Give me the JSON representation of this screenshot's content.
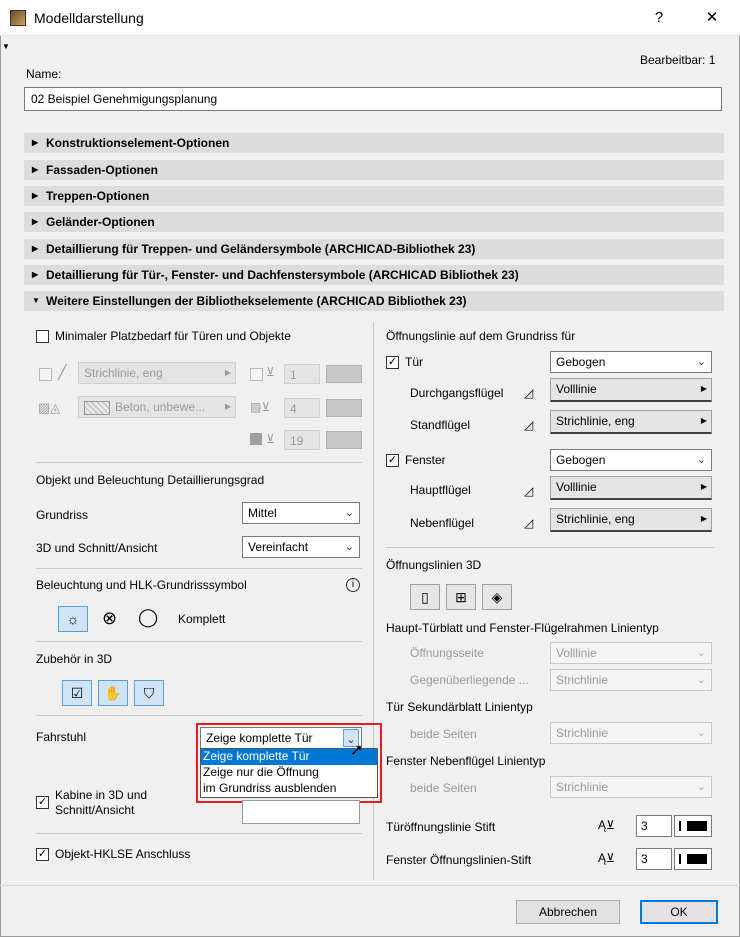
{
  "window": {
    "title": "Modelldarstellung",
    "help": "?",
    "close": "✕"
  },
  "editable": "Bearbeitbar: 1",
  "name": {
    "label": "Name:",
    "value": "02 Beispiel Genehmigungsplanung"
  },
  "sections": [
    "Konstruktionselement-Optionen",
    "Fassaden-Optionen",
    "Treppen-Optionen",
    "Geländer-Optionen",
    "Detaillierung für Treppen- und Geländersymbole (ARCHICAD-Bibliothek 23)",
    "Detaillierung für Tür-, Fenster- und Dachfenstersymbole (ARCHICAD Bibliothek 23)",
    "Weitere Einstellungen der Bibliothekselemente (ARCHICAD Bibliothek 23)"
  ],
  "left": {
    "min_space": "Minimaler Platzbedarf für Türen und Objekte",
    "line_type": "Strichlinie, eng",
    "fill": "Beton, unbewe...",
    "pen1": "1",
    "pen2": "4",
    "pen3": "19",
    "detail_title": "Objekt und Beleuchtung Detaillierungsgrad",
    "grundriss_label": "Grundriss",
    "grundriss_value": "Mittel",
    "schnitt_label": "3D und Schnitt/Ansicht",
    "schnitt_value": "Vereinfacht",
    "lighting_title": "Beleuchtung und HLK-Grundrisssymbol",
    "lighting_value": "Komplett",
    "zubehoer_title": "Zubehör in 3D",
    "fahrstuhl_label": "Fahrstuhl",
    "fahrstuhl_value": "Zeige komplette Tür",
    "fahrstuhl_options": [
      "Zeige komplette Tür",
      "Zeige nur die Öffnung",
      "im Grundriss ausblenden"
    ],
    "kabine": "Kabine in 3D und Schnitt/Ansicht",
    "hklse": "Objekt-HKLSE Anschluss"
  },
  "right": {
    "open_title": "Öffnungslinie auf dem Grundriss für",
    "tuer": "Tür",
    "tuer_value": "Gebogen",
    "durchgang": "Durchgangsflügel",
    "durchgang_line": "Volllinie",
    "stand": "Standflügel",
    "stand_line": "Strichlinie, eng",
    "fenster": "Fenster",
    "fenster_value": "Gebogen",
    "haupt": "Hauptflügel",
    "haupt_line": "Volllinie",
    "neben": "Nebenflügel",
    "neben_line": "Strichlinie, eng",
    "lines3d": "Öffnungslinien 3D",
    "haupt_tuer_title": "Haupt-Türblatt und Fenster-Flügelrahmen Linientyp",
    "oeffnungsseite": "Öffnungsseite",
    "oeffnungsseite_value": "Volllinie",
    "gegen": "Gegenüberliegende ...",
    "gegen_value": "Strichlinie",
    "sek_title": "Tür Sekundärblatt Linientyp",
    "beide1": "beide Seiten",
    "beide1_value": "Strichlinie",
    "neben_title": "Fenster Nebenflügel Linientyp",
    "beide2": "beide Seiten",
    "beide2_value": "Strichlinie",
    "pen_tuer": "Türöffnungslinie Stift",
    "pen_tuer_value": "3",
    "pen_fenster": "Fenster Öffnungslinien-Stift",
    "pen_fenster_value": "3"
  },
  "buttons": {
    "cancel": "Abbrechen",
    "ok": "OK"
  }
}
